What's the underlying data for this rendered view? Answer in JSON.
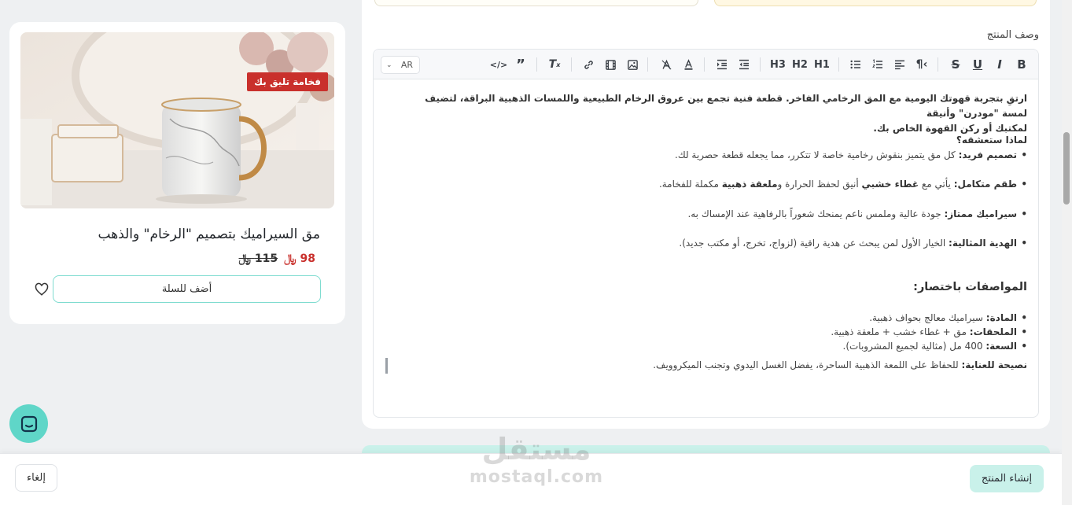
{
  "product_card": {
    "badge": "فخامة تليق بك",
    "title": "مق السيراميك بتصميم \"الرخام\" والذهب",
    "price_new": "98",
    "price_old": "115",
    "currency_symbol": "﷼",
    "add_to_cart": "أضف للسلة",
    "accent_color": "#c9302c"
  },
  "editor": {
    "field_label": "وصف المنتج",
    "language": "AR",
    "toolbar_icons": [
      "bold-icon",
      "italic-icon",
      "underline-icon",
      "strikethrough-icon",
      "paragraph-direction-icon",
      "align-icon",
      "ordered-list-icon",
      "bullet-list-icon",
      "heading-1-icon",
      "heading-2-icon",
      "heading-3-icon",
      "outdent-icon",
      "indent-icon",
      "text-color-icon",
      "highlight-icon",
      "image-icon",
      "video-icon",
      "link-icon",
      "clear-format-icon",
      "quote-icon",
      "code-icon"
    ],
    "toolbar_labels": {
      "h1": "H1",
      "h2": "H2",
      "h3": "H3",
      "bold": "B",
      "italic": "I",
      "underline": "U",
      "strike": "S",
      "quote": "99"
    },
    "intro_line1": "ارتقِ بتجربة قهوتك اليومية مع المق الرخامي الفاخر. قطعة فنية تجمع بين عروق الرخام الطبيعية واللمسات الذهبية البراقة، لتضيف لمسة \"مودرن\" وأنيقة",
    "intro_line2": "لمكتبك أو ركن القهوة الخاص بك.",
    "why_title": "لماذا ستعشقه؟",
    "features": [
      {
        "label": "تصميم فريد:",
        "text": "كل مق يتميز بنقوش رخامية خاصة لا تتكرر، مما يجعله قطعة حصرية لك."
      },
      {
        "label": "طقم متكامل:",
        "text_pre": "يأتي مع ",
        "bold1": "غطاء خشبي",
        "text_mid": " أنيق لحفظ الحرارة و",
        "bold2": "ملعقة ذهبية",
        "text_post": " مكملة للفخامة."
      },
      {
        "label": "سيراميك ممتاز:",
        "text": "جودة عالية وملمس ناعم يمنحك شعوراً بالرفاهية عند الإمساك به."
      },
      {
        "label": "الهدية المثالية:",
        "text": "الخيار الأول لمن يبحث عن هدية راقية (لزواج، تخرج، أو مكتب جديد)."
      }
    ],
    "specs_title": "المواصفات باختصار:",
    "specs": [
      {
        "label": "المادة:",
        "text": "سيراميك معالج بحواف ذهبية."
      },
      {
        "label": "الملحقات:",
        "text": "مق + غطاء خشب + ملعقة ذهبية."
      },
      {
        "label": "السعة:",
        "text": "400 مل (مثالية لجميع المشروبات)."
      }
    ],
    "care_label": "نصيحة للعناية:",
    "care_text": "للحفاظ على اللمعة الذهبية الساحرة، يفضل الغسل اليدوي وتجنب الميكروويف."
  },
  "footer": {
    "cancel": "إلغاء",
    "create": "إنشاء المنتج",
    "create_color": "#c9f1ea"
  },
  "watermark": {
    "arabic": "مستقل",
    "latin": "mostaql.com"
  }
}
